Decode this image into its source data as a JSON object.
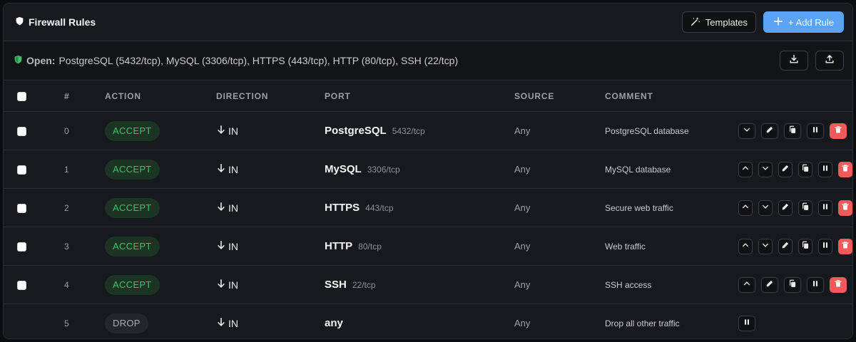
{
  "header": {
    "title": "Firewall Rules",
    "templates_label": "Templates",
    "add_rule_label": "+ Add Rule"
  },
  "openbar": {
    "label": "Open:",
    "text": "PostgreSQL (5432/tcp), MySQL (3306/tcp), HTTPS (443/tcp), HTTP (80/tcp), SSH (22/tcp)"
  },
  "table": {
    "columns": [
      "#",
      "ACTION",
      "DIRECTION",
      "PORT",
      "SOURCE",
      "COMMENT"
    ],
    "rows": [
      {
        "num": "0",
        "action": "ACCEPT",
        "direction": "IN",
        "port_name": "PostgreSQL",
        "port_num": "5432/tcp",
        "source": "Any",
        "comment": "PostgreSQL database"
      },
      {
        "num": "1",
        "action": "ACCEPT",
        "direction": "IN",
        "port_name": "MySQL",
        "port_num": "3306/tcp",
        "source": "Any",
        "comment": "MySQL database"
      },
      {
        "num": "2",
        "action": "ACCEPT",
        "direction": "IN",
        "port_name": "HTTPS",
        "port_num": "443/tcp",
        "source": "Any",
        "comment": "Secure web traffic"
      },
      {
        "num": "3",
        "action": "ACCEPT",
        "direction": "IN",
        "port_name": "HTTP",
        "port_num": "80/tcp",
        "source": "Any",
        "comment": "Web traffic"
      },
      {
        "num": "4",
        "action": "ACCEPT",
        "direction": "IN",
        "port_name": "SSH",
        "port_num": "22/tcp",
        "source": "Any",
        "comment": "SSH access"
      },
      {
        "num": "5",
        "action": "DROP",
        "direction": "IN",
        "port_name": "any",
        "port_num": "",
        "source": "Any",
        "comment": "Drop all other traffic"
      }
    ]
  },
  "colors": {
    "accent": "#5ba4f5",
    "accept": "#3fc06a",
    "danger": "#f15a5a",
    "shield": "#3fc06a"
  },
  "icons": [
    "shield-icon",
    "magic-wand-icon",
    "plus-icon",
    "shield-check-icon",
    "download-icon",
    "upload-icon",
    "arrow-down-icon",
    "chevron-up-icon",
    "chevron-down-icon",
    "edit-icon",
    "copy-icon",
    "pause-icon",
    "trash-icon"
  ]
}
